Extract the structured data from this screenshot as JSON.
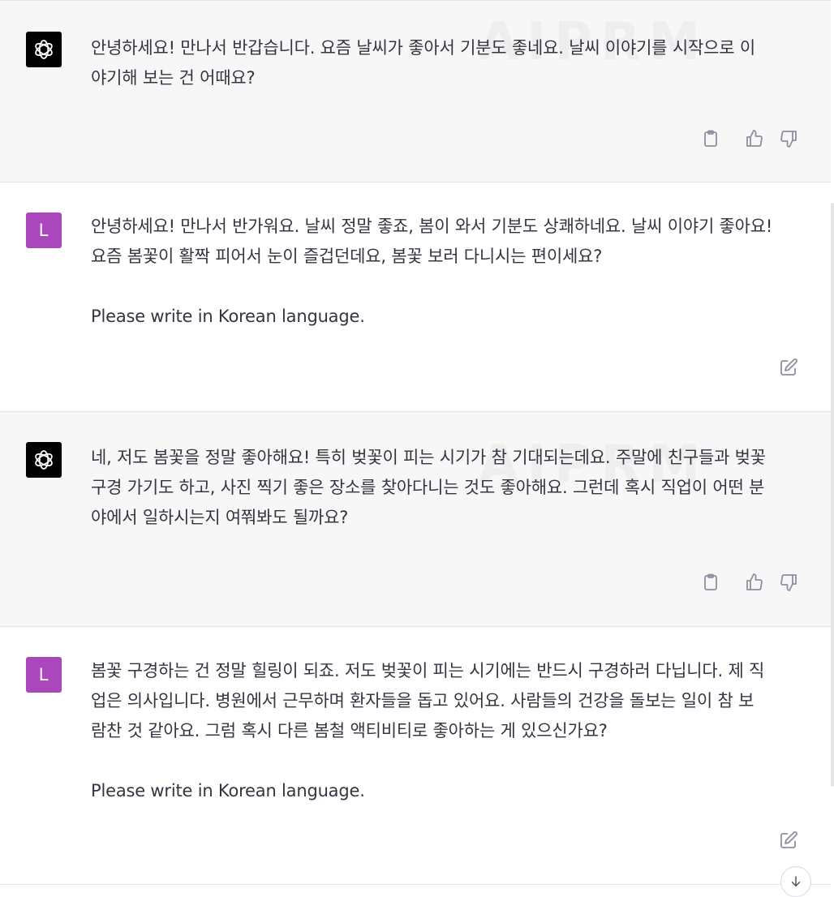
{
  "watermark": "AIPRM",
  "messages": [
    {
      "role": "assistant",
      "avatar_icon": "openai-logo-icon",
      "text": "안녕하세요! 만나서 반갑습니다. 요즘 날씨가 좋아서 기분도 좋네요. 날씨 이야기를 시작으로 이\n야기해 보는 건 어때요?"
    },
    {
      "role": "user",
      "avatar_letter": "L",
      "text": "안녕하세요! 만나서 반가워요. 날씨 정말 좋죠, 봄이 와서 기분도 상쾌하네요. 날씨 이야기 좋아요!\n요즘 봄꽃이 활짝 피어서 눈이 즐겁던데요, 봄꽃 보러 다니시는 편이세요?\n\nPlease write in Korean language."
    },
    {
      "role": "assistant",
      "avatar_icon": "openai-logo-icon",
      "text": "네, 저도 봄꽃을 정말 좋아해요! 특히 벚꽃이 피는 시기가 참 기대되는데요. 주말에 친구들과 벚꽃\n구경 가기도 하고, 사진 찍기 좋은 장소를 찾아다니는 것도 좋아해요. 그런데 혹시 직업이 어떤 분\n야에서 일하시는지 여쭤봐도 될까요?"
    },
    {
      "role": "user",
      "avatar_letter": "L",
      "text": "봄꽃 구경하는 건 정말 힐링이 되죠. 저도 벚꽃이 피는 시기에는 반드시 구경하러 다닙니다. 제 직\n업은 의사입니다. 병원에서 근무하며 환자들을 돕고 있어요. 사람들의 건강을 돌보는 일이 참 보\n람찬 것 같아요. 그럼 혹시 다른 봄철 액티비티로 좋아하는 게 있으신가요?\n\nPlease write in Korean language."
    }
  ]
}
